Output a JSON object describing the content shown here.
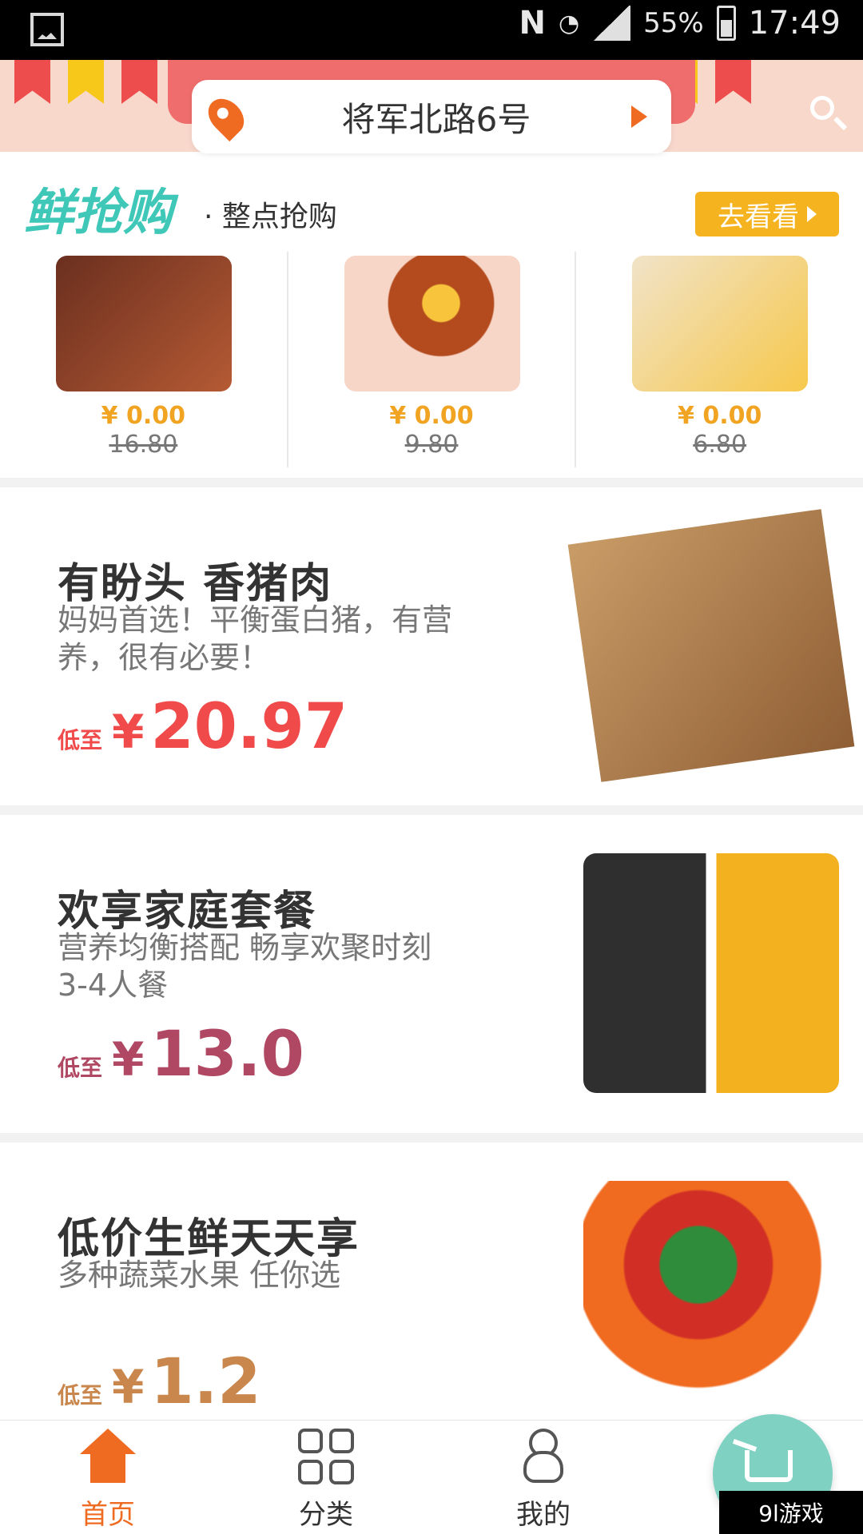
{
  "status_bar": {
    "battery": "55%",
    "time": "17:49",
    "network_icon": "n-icon",
    "wifi_icon": "wifi-icon",
    "signal_icon": "signal-icon",
    "battery_icon": "battery-icon",
    "photo_icon": "image-icon"
  },
  "header": {
    "address": "将军北路6号"
  },
  "flash_sale": {
    "logo": "鲜抢购",
    "subtitle": "· 整点抢购",
    "button": "去看看",
    "items": [
      {
        "price_now": "¥ 0.00",
        "price_old": "16.80"
      },
      {
        "price_now": "¥ 0.00",
        "price_old": "9.80"
      },
      {
        "price_now": "¥ 0.00",
        "price_old": "6.80"
      }
    ]
  },
  "promos": [
    {
      "title": "有盼头 香猪肉",
      "desc": "妈妈首选！平衡蛋白猪，有营养，很有必要！",
      "low": "低至",
      "yen": "¥",
      "price": "20.97",
      "color": "#f04a4a"
    },
    {
      "title": "欢享家庭套餐",
      "desc": "营养均衡搭配 畅享欢聚时刻 3-4人餐",
      "low": "低至",
      "yen": "¥",
      "price": "13.0",
      "color": "#b04863"
    },
    {
      "title": "低价生鲜天天享",
      "desc": "多种蔬菜水果 任你选",
      "low": "低至",
      "yen": "¥",
      "price": "1.2",
      "color": "#c9874d"
    }
  ],
  "bottom_nav": {
    "home": "首页",
    "category": "分类",
    "profile": "我的"
  },
  "watermark": "9l游戏"
}
